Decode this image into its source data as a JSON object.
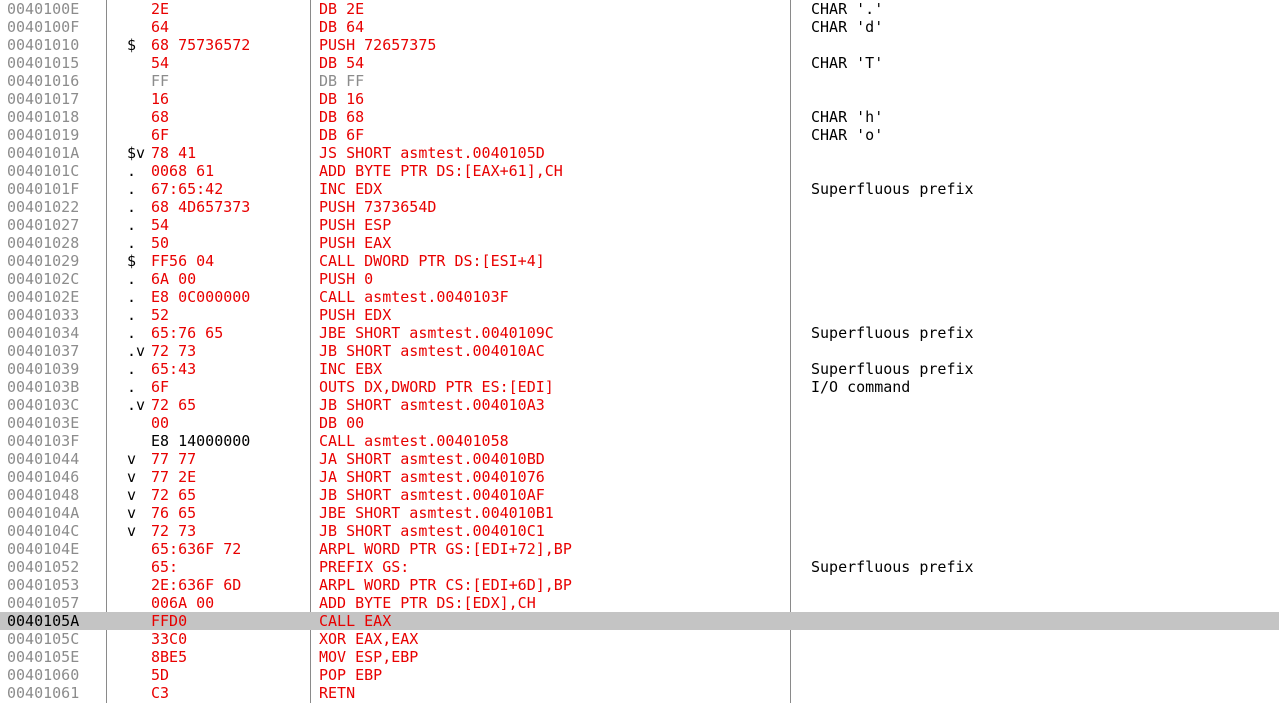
{
  "colors": {
    "address": "#8c8c8c",
    "code": "#e80000",
    "gray_code": "#8c8c8c",
    "selection": "#c4c4c4",
    "comment": "#000000"
  },
  "rows": [
    {
      "addr": "0040100E",
      "mark": "",
      "hex": "2E",
      "asm": "DB 2E",
      "comment": "CHAR '.'",
      "color": "#e80000"
    },
    {
      "addr": "0040100F",
      "mark": "",
      "hex": "64",
      "asm": "DB 64",
      "comment": "CHAR 'd'",
      "color": "#e80000"
    },
    {
      "addr": "00401010",
      "mark": "$",
      "hex": "68 75736572",
      "asm": "PUSH 72657375",
      "comment": "",
      "color": "#e80000"
    },
    {
      "addr": "00401015",
      "mark": "",
      "hex": "54",
      "asm": "DB 54",
      "comment": "CHAR 'T'",
      "color": "#e80000"
    },
    {
      "addr": "00401016",
      "mark": "",
      "hex": "FF",
      "asm": "DB FF",
      "comment": "",
      "color": "#8c8c8c"
    },
    {
      "addr": "00401017",
      "mark": "",
      "hex": "16",
      "asm": "DB 16",
      "comment": "",
      "color": "#e80000"
    },
    {
      "addr": "00401018",
      "mark": "",
      "hex": "68",
      "asm": "DB 68",
      "comment": "CHAR 'h'",
      "color": "#e80000"
    },
    {
      "addr": "00401019",
      "mark": "",
      "hex": "6F",
      "asm": "DB 6F",
      "comment": "CHAR 'o'",
      "color": "#e80000"
    },
    {
      "addr": "0040101A",
      "mark": "$v",
      "hex": "78 41",
      "asm": "JS SHORT asmtest.0040105D",
      "comment": "",
      "color": "#e80000"
    },
    {
      "addr": "0040101C",
      "mark": ".",
      "hex": "0068 61",
      "asm": "ADD BYTE PTR DS:[EAX+61],CH",
      "comment": "",
      "color": "#e80000"
    },
    {
      "addr": "0040101F",
      "mark": ".",
      "hex": "67:65:42",
      "asm": "INC EDX",
      "comment": "Superfluous prefix",
      "color": "#e80000"
    },
    {
      "addr": "00401022",
      "mark": ".",
      "hex": "68 4D657373",
      "asm": "PUSH 7373654D",
      "comment": "",
      "color": "#e80000"
    },
    {
      "addr": "00401027",
      "mark": ".",
      "hex": "54",
      "asm": "PUSH ESP",
      "comment": "",
      "color": "#e80000"
    },
    {
      "addr": "00401028",
      "mark": ".",
      "hex": "50",
      "asm": "PUSH EAX",
      "comment": "",
      "color": "#e80000"
    },
    {
      "addr": "00401029",
      "mark": "$",
      "hex": "FF56 04",
      "asm": "CALL DWORD PTR DS:[ESI+4]",
      "comment": "",
      "color": "#e80000"
    },
    {
      "addr": "0040102C",
      "mark": ".",
      "hex": "6A 00",
      "asm": "PUSH 0",
      "comment": "",
      "color": "#e80000"
    },
    {
      "addr": "0040102E",
      "mark": ".",
      "hex": "E8 0C000000",
      "asm": "CALL asmtest.0040103F",
      "comment": "",
      "color": "#e80000"
    },
    {
      "addr": "00401033",
      "mark": ".",
      "hex": "52",
      "asm": "PUSH EDX",
      "comment": "",
      "color": "#e80000"
    },
    {
      "addr": "00401034",
      "mark": ".",
      "hex": "65:76 65",
      "asm": "JBE SHORT asmtest.0040109C",
      "comment": "Superfluous prefix",
      "color": "#e80000"
    },
    {
      "addr": "00401037",
      "mark": ".v",
      "hex": "72 73",
      "asm": "JB SHORT asmtest.004010AC",
      "comment": "",
      "color": "#e80000"
    },
    {
      "addr": "00401039",
      "mark": ".",
      "hex": "65:43",
      "asm": "INC EBX",
      "comment": "Superfluous prefix",
      "color": "#e80000"
    },
    {
      "addr": "0040103B",
      "mark": ".",
      "hex": "6F",
      "asm": "OUTS DX,DWORD PTR ES:[EDI]",
      "comment": "I/O command",
      "color": "#e80000"
    },
    {
      "addr": "0040103C",
      "mark": ".v",
      "hex": "72 65",
      "asm": "JB SHORT asmtest.004010A3",
      "comment": "",
      "color": "#e80000"
    },
    {
      "addr": "0040103E",
      "mark": "",
      "hex": "00",
      "asm": "DB 00",
      "comment": "",
      "color": "#e80000"
    },
    {
      "addr": "0040103F",
      "mark": "",
      "hex": "E8 14000000",
      "asm": "CALL asmtest.00401058",
      "comment": "",
      "color": "#e80000",
      "hex_black": true
    },
    {
      "addr": "00401044",
      "mark": "v",
      "hex": "77 77",
      "asm": "JA SHORT asmtest.004010BD",
      "comment": "",
      "color": "#e80000"
    },
    {
      "addr": "00401046",
      "mark": "v",
      "hex": "77 2E",
      "asm": "JA SHORT asmtest.00401076",
      "comment": "",
      "color": "#e80000"
    },
    {
      "addr": "00401048",
      "mark": "v",
      "hex": "72 65",
      "asm": "JB SHORT asmtest.004010AF",
      "comment": "",
      "color": "#e80000"
    },
    {
      "addr": "0040104A",
      "mark": "v",
      "hex": "76 65",
      "asm": "JBE SHORT asmtest.004010B1",
      "comment": "",
      "color": "#e80000"
    },
    {
      "addr": "0040104C",
      "mark": "v",
      "hex": "72 73",
      "asm": "JB SHORT asmtest.004010C1",
      "comment": "",
      "color": "#e80000"
    },
    {
      "addr": "0040104E",
      "mark": "",
      "hex": "65:636F 72",
      "asm": "ARPL WORD PTR GS:[EDI+72],BP",
      "comment": "",
      "color": "#e80000"
    },
    {
      "addr": "00401052",
      "mark": "",
      "hex": "65:",
      "asm": "PREFIX GS:",
      "comment": "Superfluous prefix",
      "color": "#e80000"
    },
    {
      "addr": "00401053",
      "mark": "",
      "hex": "2E:636F 6D",
      "asm": "ARPL WORD PTR CS:[EDI+6D],BP",
      "comment": "",
      "color": "#e80000"
    },
    {
      "addr": "00401057",
      "mark": "",
      "hex": "006A 00",
      "asm": "ADD BYTE PTR DS:[EDX],CH",
      "comment": "",
      "color": "#e80000"
    },
    {
      "addr": "0040105A",
      "mark": "",
      "hex": "FFD0",
      "asm": "CALL EAX",
      "comment": "",
      "color": "#e80000",
      "selected": true
    },
    {
      "addr": "0040105C",
      "mark": "",
      "hex": "33C0",
      "asm": "XOR EAX,EAX",
      "comment": "",
      "color": "#e80000"
    },
    {
      "addr": "0040105E",
      "mark": "",
      "hex": "8BE5",
      "asm": "MOV ESP,EBP",
      "comment": "",
      "color": "#e80000"
    },
    {
      "addr": "00401060",
      "mark": "",
      "hex": "5D",
      "asm": "POP EBP",
      "comment": "",
      "color": "#e80000"
    },
    {
      "addr": "00401061",
      "mark": "",
      "hex": "C3",
      "asm": "RETN",
      "comment": "",
      "color": "#e80000"
    }
  ]
}
